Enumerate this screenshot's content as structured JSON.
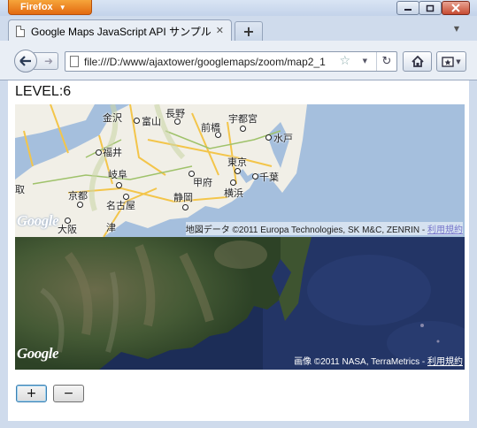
{
  "window": {
    "app_button": "Firefox",
    "controls": [
      "minimize-icon",
      "restore-icon",
      "close-icon"
    ]
  },
  "tabs": [
    {
      "label": "Google Maps JavaScript API サンプル",
      "icon": "page-icon"
    }
  ],
  "new_tab_label": "+",
  "address_bar": {
    "url": "file:///D:/www/ajaxtower/googlemaps/zoom/map2_1"
  },
  "page": {
    "level_text": "LEVEL:6",
    "road_map": {
      "logo": "Google",
      "attribution": "地図データ ©2011 Europa Technologies, SK M&C, ZENRIN - ",
      "terms_link": "利用規約",
      "cities": [
        "金沢",
        "富山",
        "長野",
        "宇都宮",
        "前橋",
        "水戸",
        "福井",
        "東京",
        "甲府",
        "千葉",
        "岐阜",
        "横浜",
        "京都",
        "名古屋",
        "静岡",
        "津",
        "大阪",
        "取"
      ]
    },
    "satellite_map": {
      "logo": "Google",
      "attribution": "画像 ©2011 NASA, TerraMetrics - ",
      "terms_link": "利用規約"
    },
    "zoom_in_label": "+",
    "zoom_out_label": "−"
  },
  "colors": {
    "road_sea": "#a5bfdd",
    "road_land": "#f1efe7",
    "sat_sea": "#1c2d57",
    "sat_land": "#4a5a38",
    "link": "#7777cc"
  }
}
